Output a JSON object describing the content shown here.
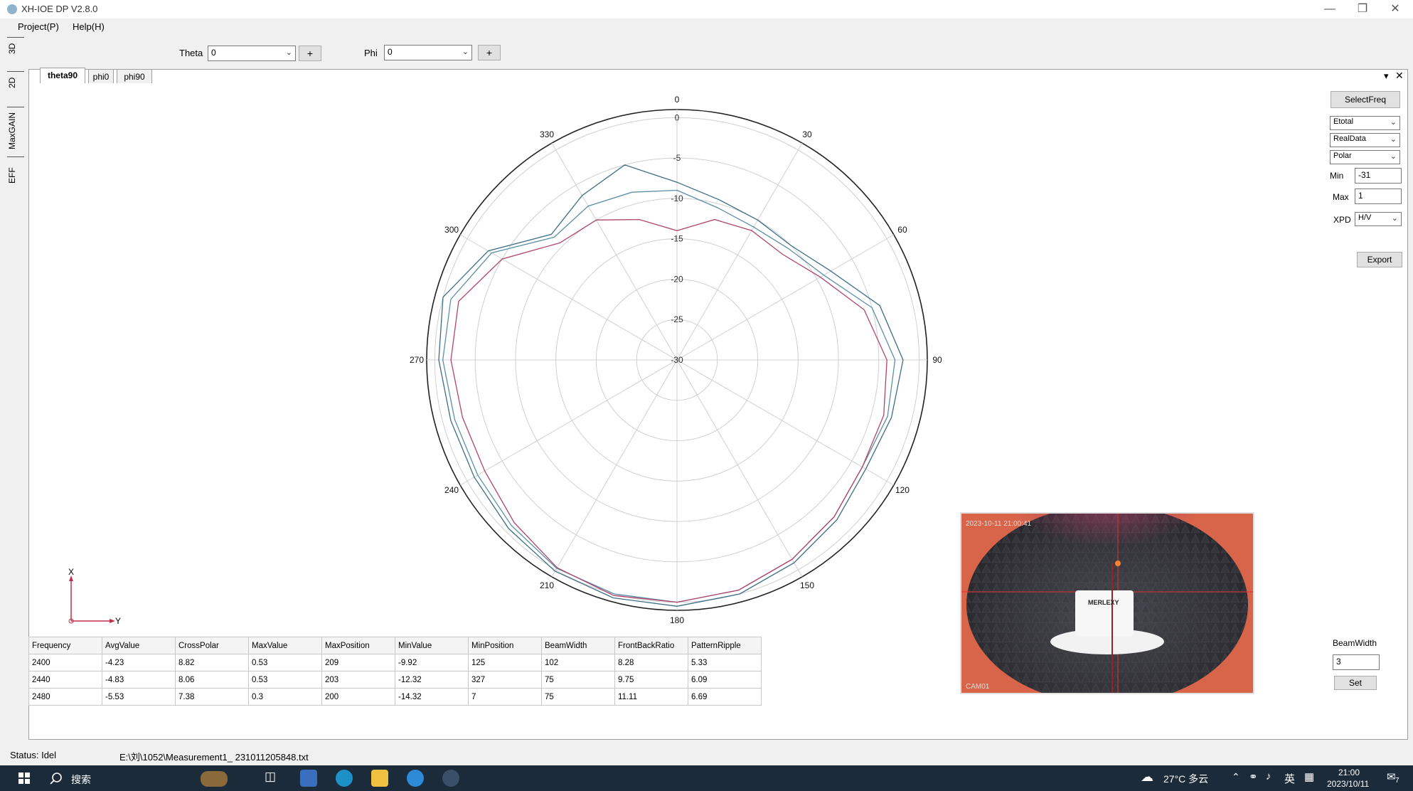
{
  "window": {
    "title": "XH-IOE DP V2.8.0"
  },
  "menu": [
    "Project(P)",
    "Help(H)"
  ],
  "side_tabs": [
    "3D",
    "2D",
    "MaxGAIN",
    "EFF"
  ],
  "toolbar": {
    "theta_label": "Theta",
    "theta_value": "0",
    "theta_add": "+",
    "phi_label": "Phi",
    "phi_value": "0",
    "phi_add": "+"
  },
  "plot_tabs": [
    "theta90",
    "phi0",
    "phi90"
  ],
  "panel_controls": {
    "dropdown": "▾",
    "close": "✕"
  },
  "right_panel": {
    "select_freq": "SelectFreq",
    "component": "Etotal",
    "data_type": "RealData",
    "plot_type": "Polar",
    "min_label": "Min",
    "min_value": "-31",
    "max_label": "Max",
    "max_value": "1",
    "xpd_label": "XPD",
    "xpd_value": "H/V",
    "export": "Export",
    "beamwidth_label": "BeamWidth",
    "beamwidth_value": "3",
    "set": "Set"
  },
  "polar": {
    "angle_labels": [
      "0",
      "30",
      "60",
      "90",
      "120",
      "150",
      "180",
      "210",
      "240",
      "270",
      "300",
      "330"
    ],
    "radial_labels": [
      "0",
      "-5",
      "-10",
      "-15",
      "-20",
      "-25",
      "-30"
    ],
    "rmin": -30,
    "rmax": 1
  },
  "axis_indicator": {
    "x": "X",
    "y": "Y"
  },
  "table": {
    "headers": [
      "Frequency",
      "AvgValue",
      "CrossPolar",
      "MaxValue",
      "MaxPosition",
      "MinValue",
      "MinPosition",
      "BeamWidth",
      "FrontBackRatio",
      "PatternRipple"
    ],
    "rows": [
      [
        "2400",
        "-4.23",
        "8.82",
        "0.53",
        "209",
        "-9.92",
        "125",
        "102",
        "8.28",
        "5.33"
      ],
      [
        "2440",
        "-4.83",
        "8.06",
        "0.53",
        "203",
        "-12.32",
        "327",
        "75",
        "9.75",
        "6.09"
      ],
      [
        "2480",
        "-5.53",
        "7.38",
        "0.3",
        "200",
        "-14.32",
        "7",
        "75",
        "11.11",
        "6.69"
      ]
    ]
  },
  "chart_data": {
    "type": "line",
    "subtype": "polar",
    "angle_unit": "deg",
    "r_range": [
      -30,
      1
    ],
    "series": [
      {
        "color": "#3d6e86",
        "points": [
          [
            0,
            -8
          ],
          [
            15,
            -9.5
          ],
          [
            30,
            -10
          ],
          [
            45,
            -10
          ],
          [
            60,
            -8
          ],
          [
            75,
            -4
          ],
          [
            90,
            -2
          ],
          [
            105,
            -2.5
          ],
          [
            120,
            -3
          ],
          [
            135,
            -2
          ],
          [
            150,
            -1
          ],
          [
            165,
            0
          ],
          [
            180,
            0.5
          ],
          [
            195,
            0.5
          ],
          [
            210,
            0.2
          ],
          [
            225,
            -0.5
          ],
          [
            240,
            -1
          ],
          [
            255,
            -1
          ],
          [
            270,
            -0.5
          ],
          [
            285,
            0
          ],
          [
            300,
            -3
          ],
          [
            315,
            -8
          ],
          [
            330,
            -6.5
          ],
          [
            345,
            -5
          ],
          [
            360,
            -8
          ]
        ]
      },
      {
        "color": "#5b8fa8",
        "points": [
          [
            0,
            -9
          ],
          [
            15,
            -10.5
          ],
          [
            30,
            -11
          ],
          [
            45,
            -10.5
          ],
          [
            60,
            -9
          ],
          [
            75,
            -5
          ],
          [
            90,
            -3
          ],
          [
            105,
            -3
          ],
          [
            120,
            -3.5
          ],
          [
            135,
            -2.5
          ],
          [
            150,
            -1.5
          ],
          [
            165,
            -0.5
          ],
          [
            180,
            0
          ],
          [
            195,
            0
          ],
          [
            210,
            -0.2
          ],
          [
            225,
            -1
          ],
          [
            240,
            -1.5
          ],
          [
            255,
            -1.5
          ],
          [
            270,
            -1
          ],
          [
            285,
            -1
          ],
          [
            300,
            -3.5
          ],
          [
            315,
            -8.5
          ],
          [
            330,
            -8
          ],
          [
            345,
            -8.5
          ],
          [
            360,
            -9
          ]
        ]
      },
      {
        "color": "#b0456e",
        "points": [
          [
            0,
            -14
          ],
          [
            15,
            -12
          ],
          [
            30,
            -11.5
          ],
          [
            45,
            -11.5
          ],
          [
            60,
            -9.5
          ],
          [
            75,
            -6
          ],
          [
            90,
            -4
          ],
          [
            105,
            -3.5
          ],
          [
            120,
            -3.5
          ],
          [
            135,
            -2.5
          ],
          [
            150,
            -1.5
          ],
          [
            165,
            -0.5
          ],
          [
            180,
            0
          ],
          [
            195,
            0.2
          ],
          [
            210,
            -0.3
          ],
          [
            225,
            -1.5
          ],
          [
            240,
            -2.5
          ],
          [
            255,
            -2.5
          ],
          [
            270,
            -2
          ],
          [
            285,
            -2
          ],
          [
            300,
            -5
          ],
          [
            315,
            -9.5
          ],
          [
            330,
            -10
          ],
          [
            345,
            -12
          ],
          [
            360,
            -14
          ]
        ]
      }
    ]
  },
  "camera": {
    "timestamp": "2023-10-11 21:00:41",
    "label": "CAM01",
    "brand": "MERLEXY"
  },
  "status": {
    "text": "Status: Idel",
    "path": "E:\\刘\\1052\\Measurement1_ 231011205848.txt"
  },
  "taskbar": {
    "search": "搜索",
    "weather": "27°C 多云",
    "ime": "英",
    "time": "21:00",
    "date": "2023/10/11",
    "notifications": "7"
  },
  "colors": {
    "accent": "#0b5f8a",
    "taskbar": "#1c2b3a"
  }
}
